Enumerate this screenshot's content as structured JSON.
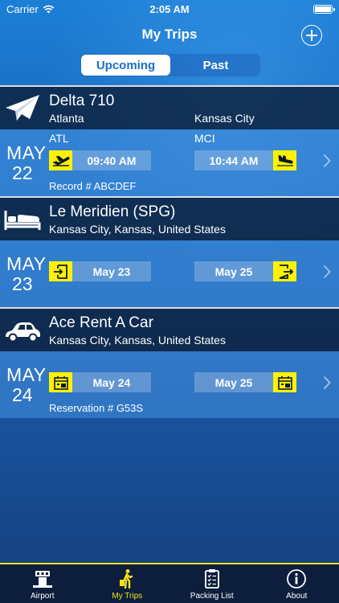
{
  "status": {
    "carrier": "Carrier",
    "time": "2:05 AM"
  },
  "nav": {
    "title": "My Trips"
  },
  "segments": {
    "upcoming": "Upcoming",
    "past": "Past",
    "selected": "Upcoming"
  },
  "trips": [
    {
      "type": "flight",
      "icon": "paper-plane-icon",
      "name": "Delta 710",
      "from": "Atlanta",
      "to": "Kansas City",
      "month": "MAY",
      "day": "22",
      "code_from": "ATL",
      "code_to": "MCI",
      "start": "09:40 AM",
      "end": "10:44 AM",
      "start_icon": "takeoff-icon",
      "end_icon": "landing-icon",
      "footnote": "Record # ABCDEF"
    },
    {
      "type": "hotel",
      "icon": "bed-icon",
      "name": "Le Meridien (SPG)",
      "location": "Kansas City, Kansas, United States",
      "month": "MAY",
      "day": "23",
      "start": "May 23",
      "end": "May 25",
      "start_icon": "check-in-icon",
      "end_icon": "check-out-icon"
    },
    {
      "type": "car",
      "icon": "car-icon",
      "name": "Ace Rent A Car",
      "location": "Kansas City, Kansas, United States",
      "month": "MAY",
      "day": "24",
      "start": "May 24",
      "end": "May 25",
      "start_icon": "pickup-calendar-icon",
      "end_icon": "return-calendar-icon",
      "footnote": "Reservation # G53S"
    }
  ],
  "tabs": [
    {
      "label": "Airport",
      "icon": "control-tower-icon"
    },
    {
      "label": "My Trips",
      "icon": "traveler-icon",
      "active": true
    },
    {
      "label": "Packing List",
      "icon": "clipboard-icon"
    },
    {
      "label": "About",
      "icon": "info-icon"
    }
  ],
  "colors": {
    "accent_yellow": "#f5e21b",
    "segment_text": "#1a6ec8",
    "tab_bar": "#0c1e3c"
  }
}
